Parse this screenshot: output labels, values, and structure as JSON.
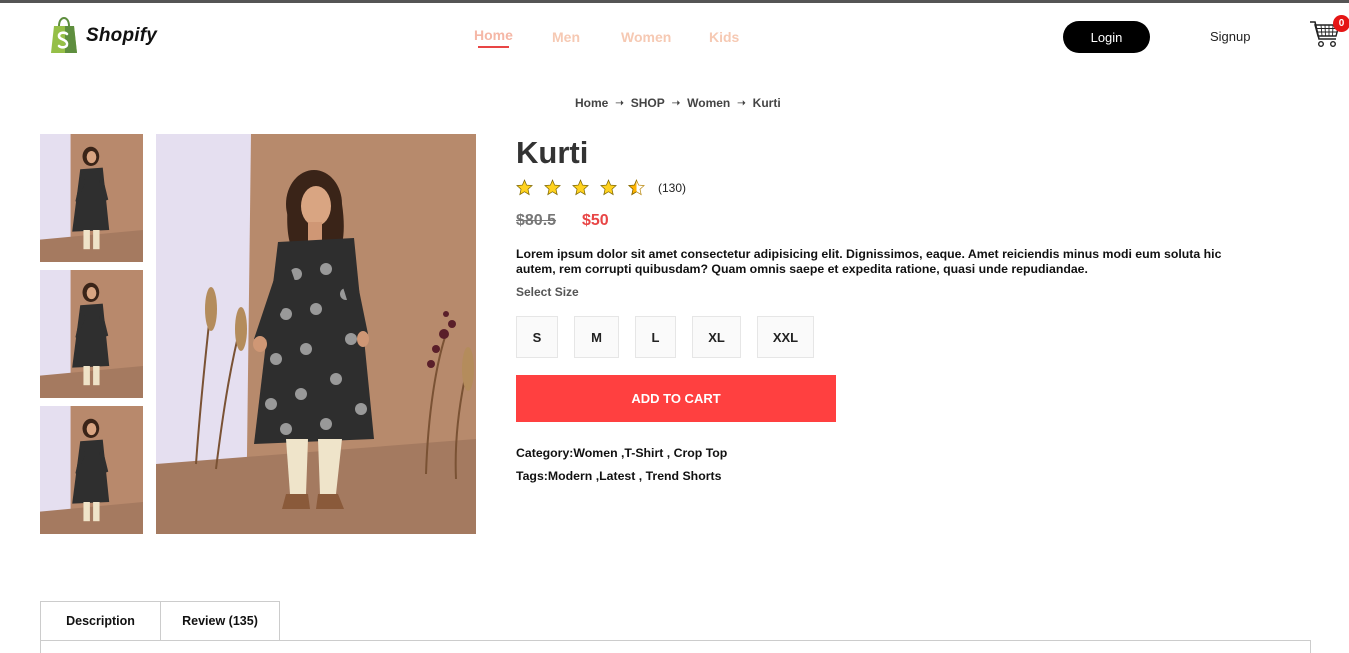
{
  "brand": {
    "name": "Shopify",
    "icon": "shopify-bag-icon"
  },
  "nav": {
    "items": [
      {
        "label": "Home",
        "active": true
      },
      {
        "label": "Men",
        "active": false
      },
      {
        "label": "Women",
        "active": false
      },
      {
        "label": "Kids",
        "active": false
      }
    ]
  },
  "auth": {
    "login_label": "Login",
    "signup_label": "Signup"
  },
  "cart": {
    "icon": "cart-icon",
    "count": "0"
  },
  "breadcrumb": {
    "items": [
      "Home",
      "SHOP",
      "Women",
      "Kurti"
    ],
    "separator_icon": "arrow-right-icon"
  },
  "product": {
    "title": "Kurti",
    "rating": 4.5,
    "rating_count": "(130)",
    "old_price": "$80.5",
    "new_price": "$50",
    "description": "Lorem ipsum dolor sit amet consectetur adipisicing elit. Dignissimos, eaque. Amet reiciendis minus modi eum soluta hic autem, rem corrupti quibusdam? Quam omnis saepe et expedita ratione, quasi unde repudiandae.",
    "size_label": "Select Size",
    "sizes": [
      "S",
      "M",
      "L",
      "XL",
      "XXL"
    ],
    "add_to_cart_label": "ADD TO CART",
    "category_text": "Category:Women ,T-Shirt , Crop Top",
    "tags_text": "Tags:Modern ,Latest , Trend Shorts"
  },
  "tabs": [
    {
      "label": "Description"
    },
    {
      "label": "Review (135)"
    }
  ],
  "colors": {
    "accent": "#ff4040",
    "price": "#e84545",
    "nav_inactive": "#f6c9b3",
    "badge": "#e51515"
  }
}
